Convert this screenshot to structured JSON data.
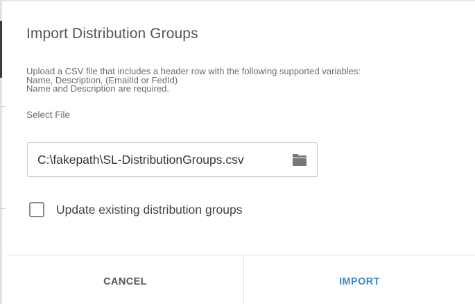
{
  "dialog": {
    "title": "Import Distribution Groups",
    "instructions": [
      "Upload a CSV file that includes a header row with the following supported variables:",
      "Name, Description, (EmailId or FedId)",
      "Name and Description are required."
    ],
    "select_file_label": "Select File",
    "file_input": {
      "value": "C:\\fakepath\\SL-DistributionGroups.csv",
      "icon": "folder-icon"
    },
    "update_checkbox": {
      "label": "Update existing distribution groups",
      "checked": false
    },
    "buttons": {
      "cancel": "CANCEL",
      "import": "IMPORT"
    }
  },
  "colors": {
    "accent": "#3f88c9",
    "title_text": "#555555",
    "secondary_text": "#6a6a6a",
    "border": "#c9c9c9",
    "icon": "#777777"
  }
}
